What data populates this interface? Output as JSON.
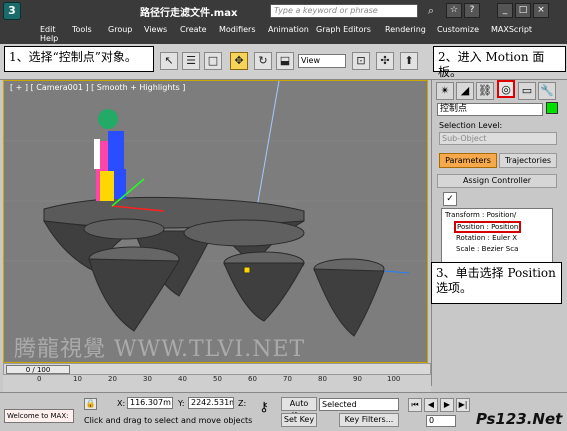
{
  "window": {
    "title": "路径行走滤文件.max",
    "search_placeholder": "Type a keyword or phrase",
    "logo_letter": "3"
  },
  "menu": [
    "Edit",
    "Tools",
    "Group",
    "Views",
    "Create",
    "Modifiers",
    "Animation",
    "Graph Editors",
    "Rendering",
    "Customize",
    "MAXScript",
    "Help"
  ],
  "toolbar": {
    "view_dropdown": "View"
  },
  "callouts": {
    "step1": "1、选择“控制点”对象。",
    "step2": "2、进入 Motion 面板。",
    "step3": "3、单击选择 Position 选项。"
  },
  "viewport": {
    "label": "[ + ] [ Camera001 ] [ Smooth + Highlights ]",
    "watermark": "腾龍視覺 WWW.TLVI.NET"
  },
  "command_panel": {
    "object_name": "控制点",
    "selection_level_label": "Selection Level:",
    "sub_object_label": "Sub-Object",
    "tab_parameters": "Parameters",
    "tab_trajectories": "Trajectories",
    "assign_controller": "Assign Controller",
    "tree": [
      "Transform : Position/",
      "Position : Position",
      "Rotation : Euler X",
      "Scale : Bezier Sca"
    ]
  },
  "timeline": {
    "frame_counter": "0 / 100",
    "ticks": [
      "0",
      "10",
      "20",
      "30",
      "40",
      "50",
      "60",
      "70",
      "80",
      "90",
      "100"
    ]
  },
  "status": {
    "maxscript_text": "Welcome to MAX:",
    "x_label": "X:",
    "x_value": "116.307m",
    "y_label": "Y:",
    "y_value": "2242.531m",
    "z_label": "Z:",
    "z_value": "",
    "prompt": "Click and drag to select and move objects",
    "auto_key": "Auto Key",
    "set_key": "Set Key",
    "selected_option": "Selected",
    "key_filters": "Key Filters...",
    "current_frame": "0",
    "site_logo": "Ps123.Net"
  }
}
